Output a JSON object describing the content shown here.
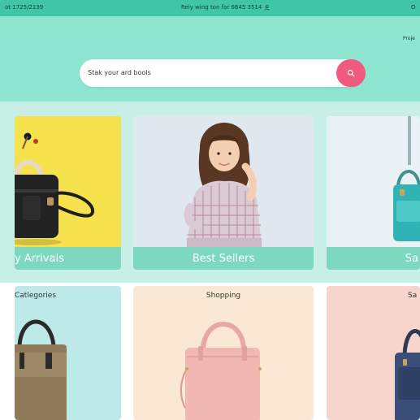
{
  "status_bar": {
    "left_text": "ot  1725/2139",
    "center_text": "Rely wing ton for 6645 3514",
    "right_text": "O"
  },
  "header": {
    "top_right_text": "Proje",
    "search": {
      "placeholder": "Stak your ard bools",
      "icon": "search-icon"
    }
  },
  "featured": [
    {
      "label": "y Arrivals"
    },
    {
      "label": "Best Sellers"
    },
    {
      "label": "Sa"
    }
  ],
  "sections": [
    {
      "title": "Catlegories"
    },
    {
      "title": "Shopping"
    },
    {
      "title": "Sa"
    }
  ],
  "colors": {
    "accent": "#3fc6a6",
    "header_bg": "#8ee6d0",
    "search_button": "#f05a7e",
    "caption_bar": "#7dd8c0"
  }
}
